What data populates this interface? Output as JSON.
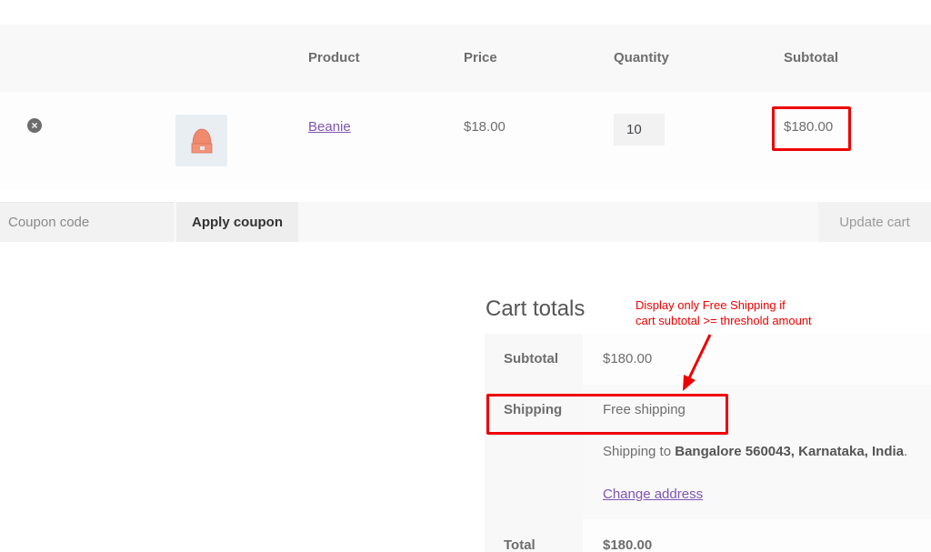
{
  "cart": {
    "headers": {
      "product": "Product",
      "price": "Price",
      "quantity": "Quantity",
      "subtotal": "Subtotal"
    },
    "items": [
      {
        "remove_icon": "×",
        "thumbnail": "beanie-image",
        "name": "Beanie",
        "price": "$18.00",
        "quantity": "10",
        "subtotal": "$180.00"
      }
    ],
    "coupon": {
      "placeholder": "Coupon code",
      "apply_label": "Apply coupon"
    },
    "update_label": "Update cart"
  },
  "totals": {
    "title": "Cart totals",
    "subtotal_label": "Subtotal",
    "subtotal_value": "$180.00",
    "shipping_label": "Shipping",
    "shipping_value": "Free shipping",
    "shipping_to_prefix": "Shipping to ",
    "shipping_destination": "Bangalore 560043, Karnataka, India",
    "shipping_to_suffix": ".",
    "change_address": "Change address",
    "total_label": "Total",
    "total_value": "$180.00"
  },
  "annotation": {
    "line1": "Display only Free Shipping if",
    "line2": "cart subtotal >= threshold amount",
    "color": "#ee0000"
  },
  "colors": {
    "link": "#7f54b3",
    "highlight": "#ee0000",
    "thumbnail_bg": "#e9eef2",
    "beanie": "#f08a6c"
  }
}
